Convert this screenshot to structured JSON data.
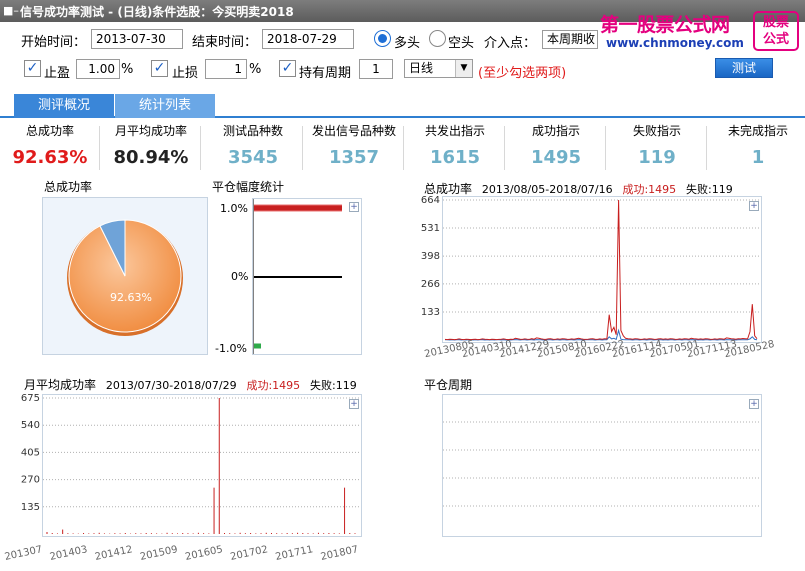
{
  "window": {
    "title": "信号成功率测试 - (日线)条件选股：今买明卖2018"
  },
  "logo": {
    "brand": "第一股票公式网",
    "url": "www.chnmoney.com",
    "seal_line1": "股票",
    "seal_line2": "公式"
  },
  "controls": {
    "start_label": "开始时间：",
    "start_value": "2013-07-30",
    "end_label": "结束时间：",
    "end_value": "2018-07-29",
    "long_label": "多头",
    "short_label": "空头",
    "entry_label": "介入点：",
    "entry_value": "本周期收",
    "take_profit_label": "止盈",
    "take_profit_value": "1.00",
    "stop_loss_label": "止损",
    "stop_loss_value": "1",
    "percent": "%",
    "hold_label": "持有周期",
    "hold_value": "1",
    "period_value": "日线",
    "hint": "(至少勾选两项)",
    "test_button": "测试"
  },
  "tabs": [
    {
      "label": "测评概况"
    },
    {
      "label": "统计列表"
    }
  ],
  "stats": [
    {
      "label": "总成功率",
      "value": "92.63%",
      "color": "#e01b1b"
    },
    {
      "label": "月平均成功率",
      "value": "80.94%",
      "color": "#222222"
    },
    {
      "label": "测试品种数",
      "value": "3545",
      "color": "#6fb0c8"
    },
    {
      "label": "发出信号品种数",
      "value": "1357",
      "color": "#6fb0c8"
    },
    {
      "label": "共发出指示",
      "value": "1615",
      "color": "#6fb0c8"
    },
    {
      "label": "成功指示",
      "value": "1495",
      "color": "#6fb0c8"
    },
    {
      "label": "失败指示",
      "value": "119",
      "color": "#6fb0c8"
    },
    {
      "label": "未完成指示",
      "value": "1",
      "color": "#6fb0c8"
    }
  ],
  "panels": {
    "pie_title": "总成功率",
    "pie_label": "92.63%",
    "range_title": "平仓幅度统计",
    "range_ticks": [
      "1.0%",
      "0%",
      "-1.0%"
    ],
    "daily_title": "总成功率",
    "daily_range": "2013/08/05-2018/07/16",
    "success_label": "成功:",
    "success_value": "1495",
    "fail_label": "失败:",
    "fail_value": "119",
    "monthly_title": "月平均成功率",
    "monthly_range": "2013/07/30-2018/07/29",
    "hold_title": "平仓周期",
    "plus": "+"
  },
  "chart_data": [
    {
      "type": "pie",
      "labels": [
        "成功",
        "失败"
      ],
      "values": [
        1495,
        119
      ],
      "colors": [
        "#f08a3c",
        "#6fa3d8"
      ]
    },
    {
      "type": "bar",
      "categories": [
        "1.0%",
        "0%",
        "-1.0%"
      ],
      "values": [
        1495,
        1,
        119
      ],
      "colors": [
        "#c82020",
        "#000000",
        "#2eaa4a"
      ]
    },
    {
      "type": "line",
      "x_ticks": [
        "20130805",
        "20140310",
        "20141229",
        "20150810",
        "20160222",
        "20161114",
        "20170501",
        "20171113",
        "20180528"
      ],
      "y_ticks": [
        133,
        266,
        398,
        531,
        664
      ],
      "ylim": [
        0,
        664
      ],
      "series": [
        {
          "name": "成功",
          "color": "#c81e1e",
          "values": [
            3,
            2,
            4,
            3,
            2,
            3,
            5,
            3,
            2,
            4,
            3,
            2,
            3,
            4,
            2,
            3,
            5,
            4,
            3,
            2,
            4,
            3,
            2,
            3,
            4,
            5,
            3,
            2,
            4,
            3,
            8,
            6,
            4,
            3,
            5,
            4,
            3,
            6,
            4,
            10,
            8,
            5,
            4,
            3,
            5,
            6,
            4,
            3,
            5,
            4,
            6,
            5,
            4,
            3,
            5,
            4,
            6,
            8,
            5,
            4,
            3,
            4,
            5,
            6,
            4,
            3,
            5,
            4,
            6,
            5,
            120,
            40,
            60,
            25,
            664,
            45,
            20,
            8,
            6,
            5,
            4,
            6,
            5,
            4,
            3,
            5,
            4,
            6,
            5,
            4,
            3,
            5,
            6,
            4,
            5,
            4,
            6,
            5,
            4,
            3,
            5,
            4,
            6,
            5,
            4,
            8,
            6,
            5,
            4,
            5,
            4,
            6,
            5,
            4,
            3,
            5,
            4,
            6,
            5,
            4,
            10,
            8,
            6,
            5,
            4,
            6,
            5,
            7,
            6,
            5,
            40,
            170,
            20,
            6
          ]
        },
        {
          "name": "失败",
          "color": "#2f6fc2",
          "values": [
            1,
            1,
            0,
            1,
            0,
            1,
            1,
            0,
            1,
            0,
            1,
            1,
            0,
            1,
            0,
            1,
            1,
            0,
            1,
            0,
            1,
            0,
            1,
            1,
            0,
            1,
            0,
            1,
            0,
            1,
            2,
            1,
            0,
            1,
            1,
            0,
            1,
            1,
            0,
            2,
            1,
            1,
            0,
            1,
            1,
            1,
            0,
            1,
            1,
            0,
            1,
            1,
            0,
            1,
            1,
            0,
            1,
            2,
            1,
            0,
            1,
            1,
            1,
            1,
            0,
            1,
            1,
            0,
            1,
            1,
            15,
            5,
            8,
            3,
            45,
            4,
            2,
            1,
            1,
            1,
            0,
            1,
            1,
            0,
            1,
            1,
            0,
            1,
            1,
            0,
            1,
            1,
            1,
            0,
            1,
            0,
            1,
            1,
            0,
            1,
            1,
            0,
            1,
            1,
            0,
            2,
            1,
            1,
            0,
            1,
            0,
            1,
            1,
            0,
            1,
            1,
            0,
            1,
            1,
            0,
            2,
            1,
            1,
            1,
            0,
            1,
            1,
            1,
            1,
            1,
            5,
            15,
            3,
            1
          ]
        }
      ]
    },
    {
      "type": "bar",
      "x_ticks": [
        "201307",
        "201403",
        "201412",
        "201509",
        "201605",
        "201702",
        "201711",
        "201807"
      ],
      "y_ticks": [
        135,
        270,
        405,
        540,
        675
      ],
      "ylim": [
        0,
        675
      ],
      "series": [
        {
          "name": "成功",
          "color": "#c81e1e",
          "values": [
            10,
            5,
            3,
            22,
            4,
            3,
            2,
            5,
            3,
            4,
            6,
            3,
            2,
            4,
            3,
            5,
            2,
            4,
            3,
            5,
            4,
            3,
            2,
            6,
            4,
            3,
            5,
            4,
            3,
            6,
            4,
            3,
            230,
            675,
            5,
            4,
            3,
            6,
            4,
            5,
            3,
            4,
            6,
            5,
            4,
            3,
            5,
            4,
            6,
            5,
            4,
            3,
            6,
            4,
            5,
            4,
            3,
            230,
            5,
            4
          ]
        }
      ]
    }
  ]
}
